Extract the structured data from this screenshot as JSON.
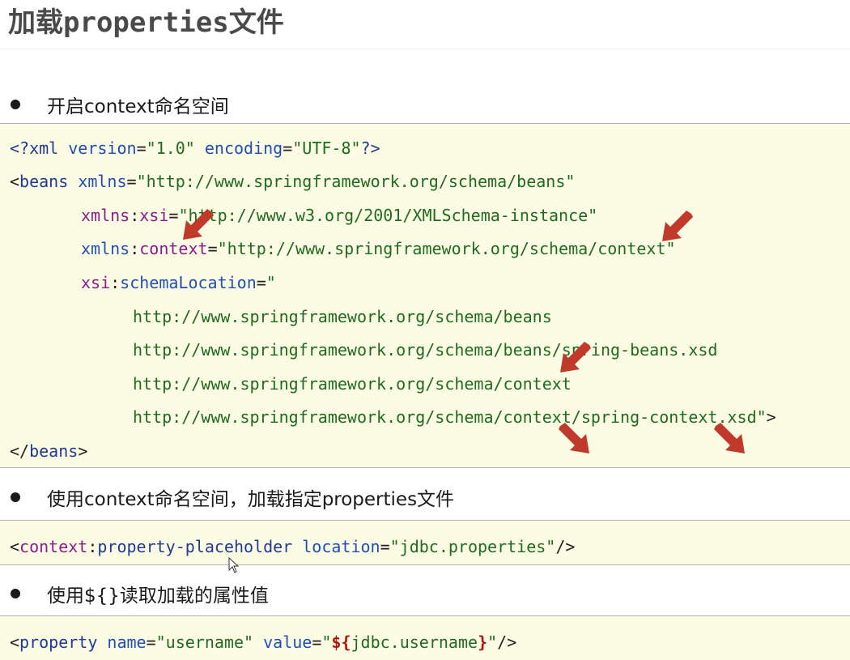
{
  "title": "加载properties文件",
  "bullets": [
    {
      "text": "开启context命名空间"
    },
    {
      "text": "使用context命名空间，加载指定properties文件"
    },
    {
      "text": "使用${}读取加载的属性值"
    }
  ],
  "code1": {
    "l1": {
      "open": "<?",
      "name": "xml",
      "a1": "version",
      "v1": "\"1.0\"",
      "a2": "encoding",
      "v2": "\"UTF-8\"",
      "close": "?>"
    },
    "l2": {
      "open": "<",
      "tag": "beans",
      "attr": "xmlns",
      "val": "\"http://www.springframework.org/schema/beans\""
    },
    "l3": {
      "ns": "xmlns",
      "colon": ":",
      "local": "xsi",
      "val": "\"http://www.w3.org/2001/XMLSchema-instance\""
    },
    "l4": {
      "ns": "xmlns",
      "colon": ":",
      "local": "context",
      "val": "\"http://www.springframework.org/schema/context\""
    },
    "l5": {
      "ns": "xsi",
      "colon": ":",
      "local": "schemaLocation",
      "val": "\""
    },
    "l6": "http://www.springframework.org/schema/beans",
    "l7": "http://www.springframework.org/schema/beans/spring-beans.xsd",
    "l8": "http://www.springframework.org/schema/context",
    "l9": {
      "url": "http://www.springframework.org/schema/context/spring-context.xsd\"",
      "close": ">"
    },
    "l10": {
      "open": "</",
      "tag": "beans",
      "close": ">"
    }
  },
  "code2": {
    "open": "<",
    "ns": "context",
    "colon": ":",
    "local": "property-placeholder",
    "attr": "location",
    "val": "\"jdbc.properties\"",
    "close": "/>"
  },
  "code3": {
    "open": "<",
    "tag": "property",
    "a1": "name",
    "v1": "\"username\"",
    "a2": "value",
    "q1": "\"",
    "expr_open": "${",
    "expr_body": "jdbc.username",
    "expr_close": "}",
    "q2": "\"",
    "close": "/>"
  },
  "colors": {
    "code_bg": "#fcfbe3",
    "arrow": "#c0392b",
    "tag": "#1f3a93",
    "namespace": "#8b1a8b",
    "attribute": "#1f4fb5",
    "string": "#1f6b1f",
    "el_expression": "#b0160e"
  },
  "icons": [
    "red-arrow-icon",
    "mouse-cursor-icon"
  ]
}
